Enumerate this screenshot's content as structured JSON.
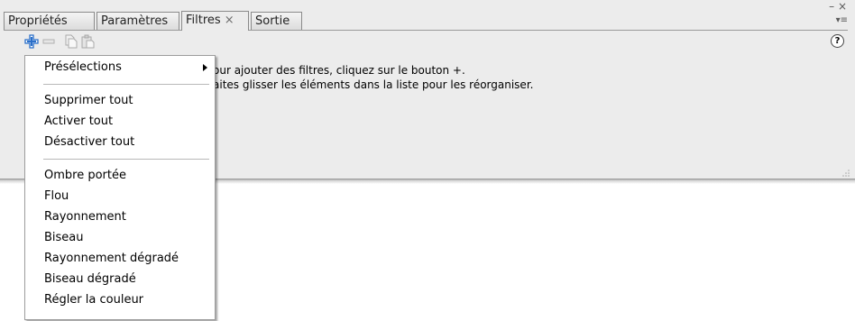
{
  "tabs": [
    {
      "label": "Propriétés"
    },
    {
      "label": "Paramètres"
    },
    {
      "label": "Filtres",
      "close": "×"
    },
    {
      "label": "Sortie"
    }
  ],
  "window_controls": {
    "minimize": "–",
    "close": "×",
    "menu": "▾≡"
  },
  "toolbar": {
    "add_icon": "plus-icon",
    "remove_icon": "minus-icon",
    "copy_icon": "copy-icon",
    "paste_icon": "paste-icon",
    "help": "?"
  },
  "hints": {
    "line1": "our ajouter des filtres, cliquez sur le bouton +.",
    "line2": "aites glisser les éléments dans la liste pour les réorganiser."
  },
  "menu": {
    "presets": "Présélections",
    "group1": [
      "Supprimer tout",
      "Activer tout",
      "Désactiver tout"
    ],
    "group2": [
      "Ombre portée",
      "Flou",
      "Rayonnement",
      "Biseau",
      "Rayonnement dégradé",
      "Biseau dégradé",
      "Régler la couleur"
    ]
  },
  "colors": {
    "panel": "#ececec",
    "accent_plus": "#2a6fc9"
  }
}
